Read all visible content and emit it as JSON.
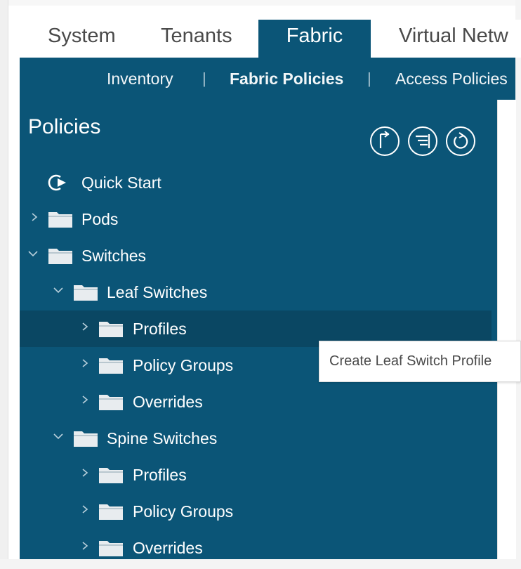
{
  "top_tabs": [
    {
      "label": "System",
      "active": false
    },
    {
      "label": "Tenants",
      "active": false
    },
    {
      "label": "Fabric",
      "active": true
    },
    {
      "label": "Virtual Netw",
      "active": false
    }
  ],
  "sub_nav": {
    "items": [
      {
        "label": "Inventory",
        "bold": false
      },
      {
        "label": "Fabric Policies",
        "bold": true
      },
      {
        "label": "Access Policies",
        "bold": false
      }
    ],
    "separator": "|"
  },
  "panel": {
    "title": "Policies",
    "action_icons": [
      "tag-icon",
      "list-icon",
      "refresh-icon"
    ]
  },
  "tree": [
    {
      "label": "Quick Start",
      "type": "quickstart",
      "indent": 0,
      "expander": "none"
    },
    {
      "label": "Pods",
      "type": "folder",
      "indent": 0,
      "expander": "collapsed"
    },
    {
      "label": "Switches",
      "type": "folder",
      "indent": 0,
      "expander": "expanded"
    },
    {
      "label": "Leaf Switches",
      "type": "folder",
      "indent": 1,
      "expander": "expanded"
    },
    {
      "label": "Profiles",
      "type": "folder",
      "indent": 2,
      "expander": "collapsed",
      "selected": true
    },
    {
      "label": "Policy Groups",
      "type": "folder",
      "indent": 2,
      "expander": "collapsed"
    },
    {
      "label": "Overrides",
      "type": "folder",
      "indent": 2,
      "expander": "collapsed"
    },
    {
      "label": "Spine Switches",
      "type": "folder",
      "indent": 1,
      "expander": "expanded"
    },
    {
      "label": "Profiles",
      "type": "folder",
      "indent": 2,
      "expander": "collapsed"
    },
    {
      "label": "Policy Groups",
      "type": "folder",
      "indent": 2,
      "expander": "collapsed"
    },
    {
      "label": "Overrides",
      "type": "folder",
      "indent": 2,
      "expander": "collapsed"
    }
  ],
  "tooltip": {
    "text": "Create Leaf Switch Profile"
  },
  "colors": {
    "panel_bg": "#0b5577",
    "selected_row_bg": "#0a4763",
    "text_light": "#ffffff",
    "folder_fill": "#e8ecef"
  }
}
